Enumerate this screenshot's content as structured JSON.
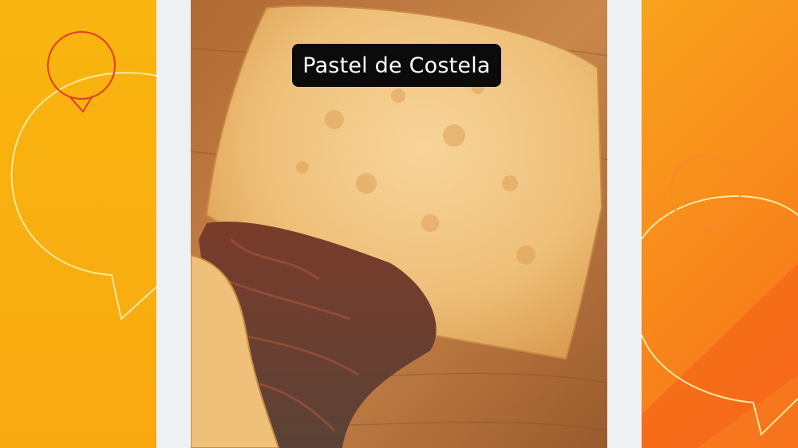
{
  "caption": {
    "text": "Pastel de Costela"
  },
  "image": {
    "description_icon": "pastel-photo"
  },
  "colors": {
    "left_bg": "#f9b50f",
    "right_bg": "#f7711c",
    "panel_bg": "#eef1f4",
    "caption_bg": "#0b0b0b",
    "caption_text": "#ffffff",
    "decor_line": "#fde7a0",
    "decor_red": "#e23b2c"
  }
}
